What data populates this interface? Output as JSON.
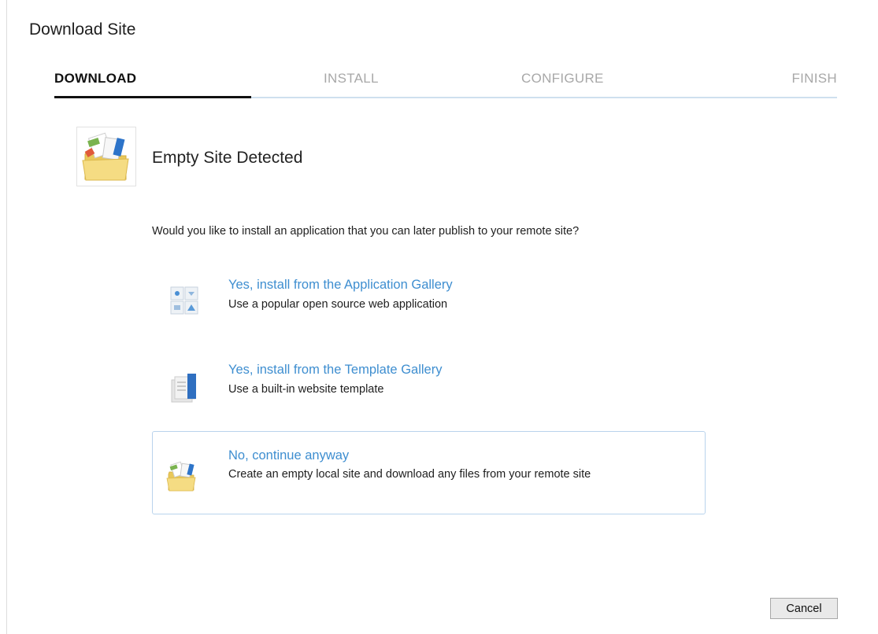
{
  "window": {
    "title": "Download Site"
  },
  "steps": [
    {
      "label": "DOWNLOAD",
      "active": true
    },
    {
      "label": "INSTALL",
      "active": false
    },
    {
      "label": "CONFIGURE",
      "active": false
    },
    {
      "label": "FINISH",
      "active": false
    }
  ],
  "header": {
    "title": "Empty Site Detected",
    "icon": "open-folder-icon"
  },
  "question": "Would you like to install an application that you can later publish to your remote site?",
  "options": [
    {
      "title": "Yes, install from the Application Gallery",
      "description": "Use a popular open source web application",
      "icon": "application-gallery-icon",
      "selected": false
    },
    {
      "title": "Yes, install from the Template Gallery",
      "description": "Use a built-in website template",
      "icon": "template-gallery-icon",
      "selected": false
    },
    {
      "title": "No, continue anyway",
      "description": "Create an empty local site and download any files from your remote site",
      "icon": "open-folder-icon",
      "selected": true
    }
  ],
  "footer": {
    "cancel_label": "Cancel"
  },
  "colors": {
    "link": "#3e8ed0",
    "selected_border": "#b9d3ec",
    "step_track": "#cfe0ef",
    "step_inactive": "#a8a8a8"
  }
}
